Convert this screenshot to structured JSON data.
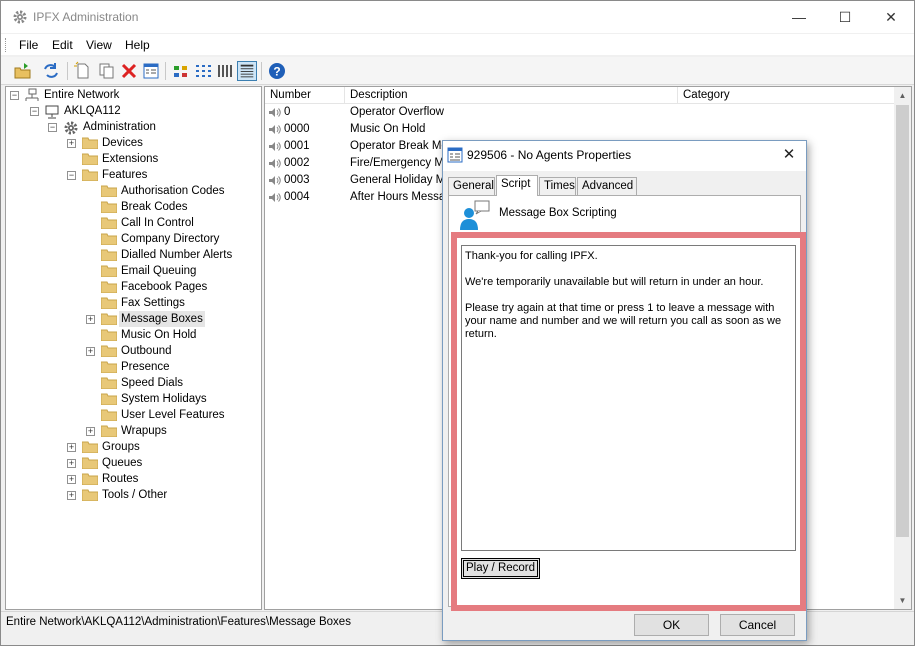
{
  "window": {
    "title": "IPFX Administration",
    "controls": {
      "minimize": "—",
      "maximize": "☐",
      "close": "✕"
    }
  },
  "menubar": {
    "items": [
      "File",
      "Edit",
      "View",
      "Help"
    ]
  },
  "toolbar": {
    "icons": [
      "open-folder-icon",
      "refresh-icon",
      "new-icon",
      "copy-icon",
      "delete-icon",
      "properties-icon",
      "large-icons-view-icon",
      "small-icons-view-icon",
      "list-view-icon",
      "details-view-icon",
      "help-icon"
    ]
  },
  "tree": {
    "root": "Entire Network",
    "server": "AKLQA112",
    "admin": "Administration",
    "nodes": [
      "Devices",
      "Extensions",
      "Features",
      "Groups",
      "Queues",
      "Routes",
      "Tools / Other"
    ],
    "features": [
      "Authorisation Codes",
      "Break Codes",
      "Call In Control",
      "Company Directory",
      "Dialled Number Alerts",
      "Email Queuing",
      "Facebook Pages",
      "Fax Settings",
      "Message Boxes",
      "Music On Hold",
      "Outbound",
      "Presence",
      "Speed Dials",
      "System Holidays",
      "User Level Features",
      "Wrapups"
    ]
  },
  "listview": {
    "columns": [
      "Number",
      "Description",
      "Category"
    ],
    "rows": [
      {
        "number": "0",
        "description": "Operator Overflow",
        "category": ""
      },
      {
        "number": "0000",
        "description": "Music On Hold",
        "category": ""
      },
      {
        "number": "0001",
        "description": "Operator Break Message",
        "category": ""
      },
      {
        "number": "0002",
        "description": "Fire/Emergency Message",
        "category": ""
      },
      {
        "number": "0003",
        "description": "General Holiday Message",
        "category": ""
      },
      {
        "number": "0004",
        "description": "After Hours Message",
        "category": ""
      }
    ]
  },
  "statusbar": {
    "path": "Entire Network\\AKLQA112\\Administration\\Features\\Message Boxes"
  },
  "dialog": {
    "title": "929506 - No Agents  Properties",
    "close": "✕",
    "tabs": [
      "General",
      "Script",
      "Times",
      "Advanced"
    ],
    "active_tab": "Script",
    "section_label": "Message Box Scripting",
    "script_lines": [
      "Thank-you for calling IPFX.",
      "We're temporarily unavailable but will return in under an hour.",
      "Please try again at that time or press 1 to leave a message with your name and number and we will return you call as soon as we return."
    ],
    "play_record_label": "Play / Record",
    "ok_label": "OK",
    "cancel_label": "Cancel",
    "highlight_color": "#e57b80"
  }
}
